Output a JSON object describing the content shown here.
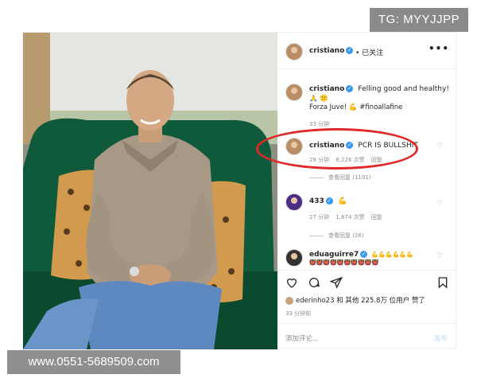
{
  "watermarks": {
    "tg": "TG: MYYJJPP",
    "url": "www.0551-5689509.com"
  },
  "header": {
    "username": "cristiano",
    "verified": "✓",
    "follow_status": "• 已关注",
    "more": "•••"
  },
  "comments": [
    {
      "username": "cristiano",
      "verified": "✓",
      "text_line1": "Felling good and healthy!",
      "text_line2": "Forza Juve! 💪 #finoallafine",
      "emoji_line": "🙏 🙂",
      "time": "33 分钟"
    },
    {
      "username": "cristiano",
      "verified": "✓",
      "text": "PCR IS BULLSHIT",
      "time": "28 分钟",
      "likes": "8,226 次赞",
      "reply": "回复",
      "view_replies": "查看回复 (1191)"
    },
    {
      "username": "433",
      "verified": "✓",
      "text": "💪",
      "time": "27 分钟",
      "likes": "1,874 次赞",
      "reply": "回复",
      "view_replies": "查看回复 (26)"
    },
    {
      "username": "eduaguirre7",
      "verified": "✓",
      "text": "💪💪💪💪💪💪",
      "text_line2": "👹👹👹👹👹👹👹👹👹👹"
    }
  ],
  "actions": {
    "like_icon": "heart-icon",
    "comment_icon": "comment-icon",
    "share_icon": "share-icon",
    "save_icon": "bookmark-icon"
  },
  "liked_by": "ederinho23 和 其他 225.8万 位用户 赞了",
  "post_time": "33 分钟前",
  "add_comment": {
    "placeholder": "添加评论...",
    "post_label": "发布"
  },
  "colors": {
    "circle": "#e02929",
    "verified": "#3897f0",
    "sofa": "#0f5a3a"
  }
}
